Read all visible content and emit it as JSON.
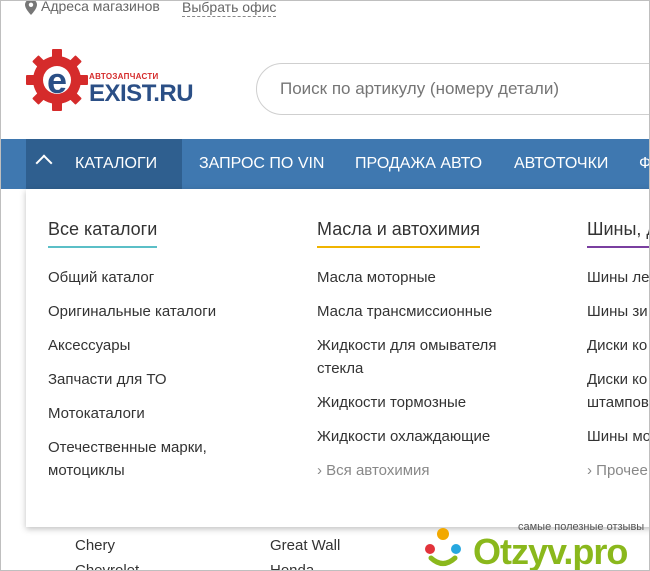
{
  "topbar": {
    "stores_label": "Адреса магазинов",
    "office_label": "Выбрать офис"
  },
  "logo": {
    "subtitle": "АВТОЗАПЧАСТИ",
    "brand": "EXIST.RU",
    "colors": {
      "red": "#d52b2b",
      "blue": "#2b4f86"
    }
  },
  "search": {
    "placeholder": "Поиск по артикулу (номеру детали)"
  },
  "nav": {
    "items": [
      {
        "label": "КАТАЛОГИ"
      },
      {
        "label": "ЗАПРОС ПО VIN"
      },
      {
        "label": "ПРОДАЖА АВТО"
      },
      {
        "label": "АВТОТОЧКИ"
      },
      {
        "label": "Ф"
      }
    ],
    "colors": {
      "bar": "#3f78b0",
      "active": "#2f5f8f"
    }
  },
  "menu": {
    "col1": {
      "title": "Все каталоги",
      "underline": "#5bbfc7",
      "items": [
        "Общий каталог",
        "Оригинальные каталоги",
        "Аксессуары",
        "Запчасти для ТО",
        "Мотокаталоги",
        "Отечественные марки, мотоциклы"
      ]
    },
    "col2": {
      "title": "Масла и автохимия",
      "underline": "#f0b400",
      "items": [
        "Масла моторные",
        "Масла трансмиссионные",
        "Жидкости для омывателя стекла",
        "Жидкости тормозные",
        "Жидкости охлаждающие"
      ],
      "more": "› Вся автохимия"
    },
    "col3": {
      "title": "Шины, д",
      "underline": "#7a3fa0",
      "items": [
        "Шины ле",
        "Шины зи",
        "Диски ко",
        "Диски ко штампов",
        "Шины мо"
      ],
      "more": "› Прочее"
    }
  },
  "below": {
    "left": [
      "Chery",
      "Chevrolet"
    ],
    "right": [
      "Great Wall",
      "Honda"
    ]
  },
  "watermark": {
    "tagline": "самые полезные отзывы",
    "word": "Otzyv.pro"
  }
}
